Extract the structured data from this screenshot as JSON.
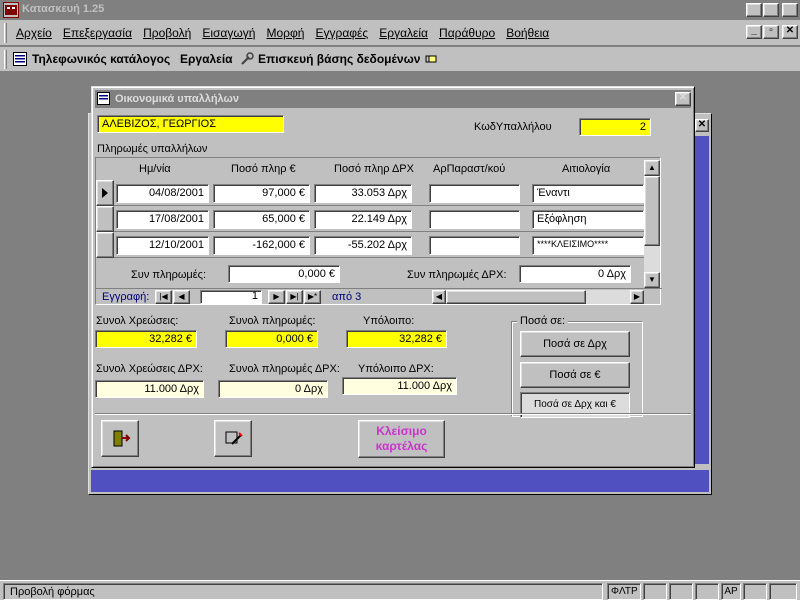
{
  "app": {
    "title": "Κατασκευή 1.25"
  },
  "menu": [
    "Αρχείο",
    "Επεξεργασία",
    "Προβολή",
    "Εισαγωγή",
    "Μορφή",
    "Εγγραφές",
    "Εργαλεία",
    "Παράθυρο",
    "Βοήθεια"
  ],
  "toolbar": {
    "phonebook": "Τηλεφωνικός κατάλογος",
    "tools": "Εργαλεία",
    "repair": "Επισκευή βάσης δεδομένων"
  },
  "form": {
    "title": "Οικονομικά υπαλλήλων",
    "employee_name": "ΑΛΕΒΙΖΟΣ, ΓΕΩΡΓΙΟΣ",
    "emp_id_label": "ΚωδΥπαλλήλου",
    "emp_id": "2",
    "payments_label": "Πληρωμές υπαλλήλων",
    "columns": [
      "Ημ/νία",
      "Ποσό πληρ €",
      "Ποσό πληρ ΔΡΧ",
      "ΑρΠαραστ/κού",
      "Αιτιολογία"
    ],
    "rows": [
      {
        "date": "04/08/2001",
        "eur": "97,000 €",
        "drx": "33.053 Δρχ",
        "doc": "",
        "reason": "Έναντι"
      },
      {
        "date": "17/08/2001",
        "eur": "65,000 €",
        "drx": "22.149 Δρχ",
        "doc": "",
        "reason": "Εξόφληση"
      },
      {
        "date": "12/10/2001",
        "eur": "-162,000 €",
        "drx": "-55.202 Δρχ",
        "doc": "",
        "reason": "****ΚΛΕΙΣΙΜΟ****"
      }
    ],
    "sum_pay_label": "Συν πληρωμές:",
    "sum_pay": "0,000 €",
    "sum_pay_drx_label": "Συν πληρωμές ΔΡΧ:",
    "sum_pay_drx": "0 Δρχ",
    "record_label": "Εγγραφή:",
    "record_num": "1",
    "record_of": "από 3",
    "tot_charges_label": "Συνολ Χρεώσεις:",
    "tot_charges": "32,282 €",
    "tot_pay_label": "Συνολ πληρωμές:",
    "tot_pay": "0,000 €",
    "balance_label": "Υπόλοιπο:",
    "balance": "32,282 €",
    "tot_charges_drx_label": "Συνολ Χρεώσεις ΔΡΧ:",
    "tot_charges_drx": "11.000 Δρχ",
    "tot_pay_drx_label": "Συνολ πληρωμές ΔΡΧ:",
    "tot_pay_drx": "0 Δρχ",
    "balance_drx_label": "Υπόλοιπο ΔΡΧ:",
    "balance_drx": "11.000 Δρχ",
    "amounts_group": "Ποσά σε:",
    "btn_drx": "Ποσά σε Δρχ",
    "btn_eur": "Ποσά σε €",
    "btn_both": "Ποσά σε Δρχ και €",
    "close_line1": "Κλείσιμο",
    "close_line2": "καρτέλας"
  },
  "status": {
    "text": "Προβολή φόρμας",
    "filter": "ΦΛΤΡ",
    "caps": "ΑΡ"
  },
  "colors": {
    "title_bar": "#000080",
    "yellow_field": "#ffff00",
    "cream_field": "#ffffe0",
    "close_text": "#cc33cc",
    "back_form": "#5050c0"
  }
}
